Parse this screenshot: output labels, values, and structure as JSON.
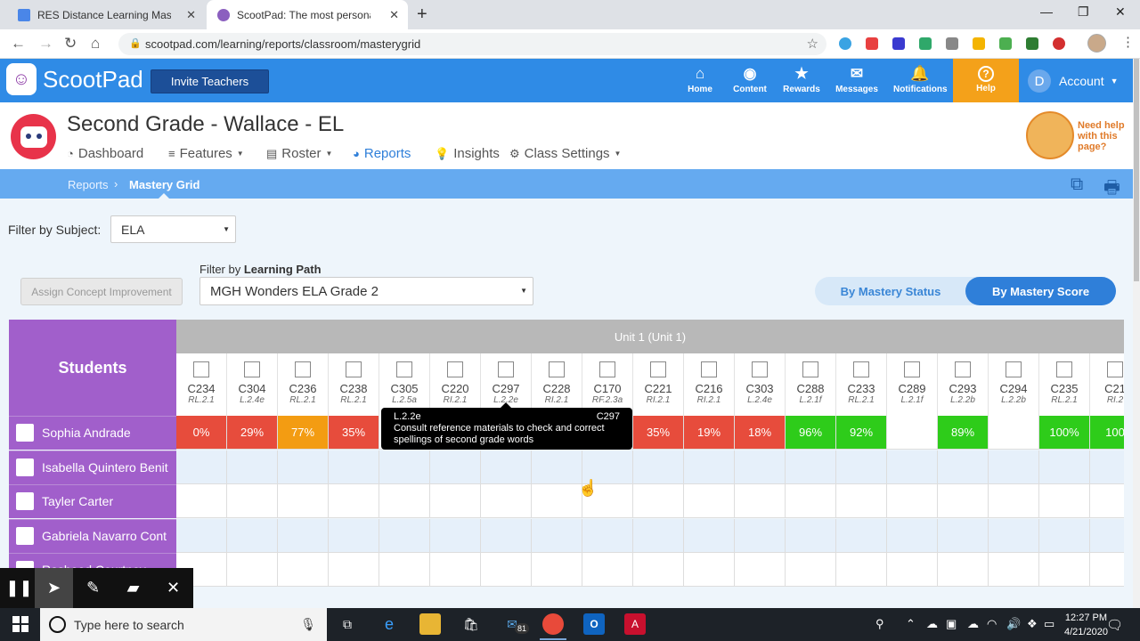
{
  "browser": {
    "tabs": [
      {
        "title": "RES Distance Learning Master Sc",
        "color": "#4a86e8"
      },
      {
        "title": "ScootPad: The most personalized",
        "color": "#8b5fbf"
      }
    ],
    "url": "scootpad.com/learning/reports/classroom/masterygrid"
  },
  "app": {
    "name": "ScootPad",
    "invite_label": "Invite Teachers",
    "nav": [
      {
        "label": "Home",
        "icon": "home-icon"
      },
      {
        "label": "Content",
        "icon": "content-icon"
      },
      {
        "label": "Rewards",
        "icon": "star-icon"
      },
      {
        "label": "Messages",
        "icon": "mail-icon"
      },
      {
        "label": "Notifications",
        "icon": "bell-icon"
      }
    ],
    "help_label": "Help",
    "account_initial": "D",
    "account_label": "Account"
  },
  "classroom": {
    "title": "Second Grade - Wallace - EL",
    "nav": [
      {
        "label": "Dashboard",
        "icon": "gauge-icon"
      },
      {
        "label": "Features",
        "icon": "menu-icon"
      },
      {
        "label": "Roster",
        "icon": "roster-icon"
      },
      {
        "label": "Reports",
        "icon": "pie-icon"
      },
      {
        "label": "Insights",
        "icon": "bulb-icon"
      },
      {
        "label": "Class Settings",
        "icon": "gear-icon"
      }
    ],
    "help_text": "Need help with this page?"
  },
  "breadcrumb": {
    "parent": "Reports",
    "current": "Mastery Grid"
  },
  "filters": {
    "subject_label": "Filter by Subject:",
    "subject_value": "ELA",
    "path_label_prefix": "Filter by",
    "path_label_bold": "Learning Path",
    "path_value": "MGH Wonders ELA Grade 2",
    "assign_label": "Assign Concept Improvement",
    "toggle": [
      "By Mastery Status",
      "By Mastery Score"
    ]
  },
  "grid": {
    "students_header": "Students",
    "unit_header": "Unit 1 (Unit 1)",
    "concepts": [
      {
        "code": "C234",
        "std": "RL.2.1"
      },
      {
        "code": "C304",
        "std": "L.2.4e"
      },
      {
        "code": "C236",
        "std": "RL.2.1"
      },
      {
        "code": "C238",
        "std": "RL.2.1"
      },
      {
        "code": "C305",
        "std": "L.2.5a"
      },
      {
        "code": "C220",
        "std": "RI.2.1"
      },
      {
        "code": "C297",
        "std": "L.2.2e"
      },
      {
        "code": "C228",
        "std": "RI.2.1"
      },
      {
        "code": "C170",
        "std": "RF.2.3a"
      },
      {
        "code": "C221",
        "std": "RI.2.1"
      },
      {
        "code": "C216",
        "std": "RI.2.1"
      },
      {
        "code": "C303",
        "std": "L.2.4e"
      },
      {
        "code": "C288",
        "std": "L.2.1f"
      },
      {
        "code": "C233",
        "std": "RL.2.1"
      },
      {
        "code": "C289",
        "std": "L.2.1f"
      },
      {
        "code": "C293",
        "std": "L.2.2b"
      },
      {
        "code": "C294",
        "std": "L.2.2b"
      },
      {
        "code": "C235",
        "std": "RL.2.1"
      },
      {
        "code": "C21",
        "std": "RI.2"
      }
    ],
    "students": [
      {
        "name": "Sophia Andrade",
        "scores": [
          "0%",
          "29%",
          "77%",
          "35%",
          "",
          "",
          "",
          "",
          "",
          "35%",
          "19%",
          "18%",
          "96%",
          "92%",
          "",
          "89%",
          "",
          "100%",
          "100"
        ]
      },
      {
        "name": "Isabella Quintero Benit",
        "scores": []
      },
      {
        "name": "Tayler Carter",
        "scores": []
      },
      {
        "name": "Gabriela Navarro Cont",
        "scores": []
      },
      {
        "name": "Rasheed Courtney",
        "scores": []
      }
    ],
    "colors": {
      "red": "#e74c3c",
      "orange": "#f39c12",
      "green": "#2ecc1a"
    }
  },
  "tooltip": {
    "standard": "L.2.2e",
    "code": "C297",
    "text": "Consult reference materials to check and correct spellings of second grade words"
  },
  "taskbar": {
    "search_placeholder": "Type here to search",
    "mail_badge": "81",
    "time": "12:27 PM",
    "date": "4/21/2020"
  }
}
